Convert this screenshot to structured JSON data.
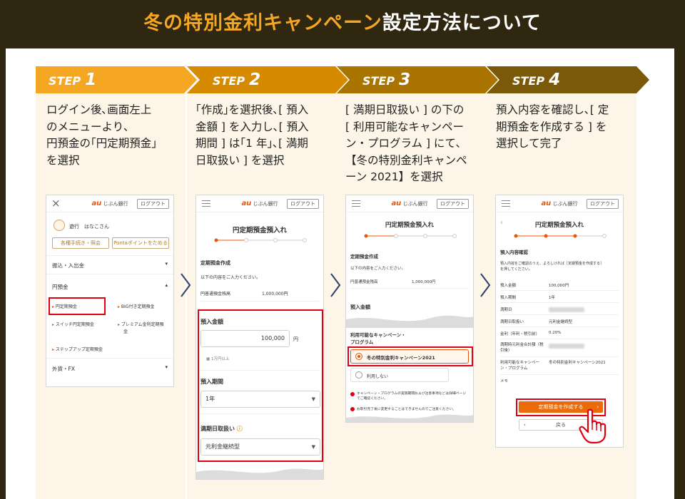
{
  "banner": {
    "title_highlight": "冬の特別金利キャンペーン",
    "title_rest": "設定方法について"
  },
  "colors": {
    "dark": "#2f2710",
    "orange": "#f5a623",
    "step1": "#f5a623",
    "step2": "#d58a00",
    "step3": "#a97400",
    "step4": "#7a5a08",
    "col_bg": "#fdf5e7",
    "red": "#e1000f",
    "brand": "#eb5505"
  },
  "steps": [
    {
      "label": "STEP",
      "num": "1",
      "lines": [
        "ログイン後､画面左上",
        "のメニューより､",
        "円預金の｢円定期預金｣",
        "を選択"
      ]
    },
    {
      "label": "STEP",
      "num": "2",
      "lines": [
        "｢作成｣を選択後､[ 預入",
        "金額 ] を入力し､[ 預入",
        "期間 ] は｢1 年｣､[ 満期",
        "日取扱い ] を選択"
      ]
    },
    {
      "label": "STEP",
      "num": "3",
      "lines": [
        "[ 満期日取扱い ] の下の",
        "[ 利用可能なキャンペー",
        "ン・プログラム ] にて､",
        "【冬の特別金利キャンペ",
        "ーン 2021】を選択"
      ]
    },
    {
      "label": "STEP",
      "num": "4",
      "lines": [
        "預入内容を確認し､[ 定",
        "期預金を作成する ] を",
        "選択して完了"
      ]
    }
  ],
  "header": {
    "au": "au",
    "bank": "じぶん銀行",
    "logout": "ログアウト"
  },
  "phone1": {
    "user": "遊行　はなこさん",
    "btn_procedures": "各種手続き・照会",
    "btn_ponta": "Pontaポイントをためる",
    "menu_transfer": "振込・入出金",
    "menu_yen": "円預金",
    "sub_items": [
      "円定期預金",
      "BIG付き定期預金",
      "スイッチ円定期預金",
      "プレミアム金利定期預",
      "金",
      "ステップアップ定期預金"
    ],
    "menu_fx": "外貨・FX"
  },
  "phone2": {
    "title": "円定期預金預入れ",
    "section": "定期預金作成",
    "instruction": "以下の内容をご入力ください。",
    "balance_label": "円普通預金残高",
    "balance_value": "1,000,000円",
    "amount_label": "預入金額",
    "amount_value": "100,000",
    "amount_unit": "円",
    "amount_note": "1万円以上",
    "period_label": "預入期間",
    "period_value": "1年",
    "maturity_label": "満期日取扱い",
    "maturity_value": "元利金継続型"
  },
  "phone3": {
    "title": "円定期預金預入れ",
    "section": "定期預金作成",
    "instruction": "以下の内容をご入力ください。",
    "balance_label": "円普通預金残高",
    "balance_value": "1,000,000円",
    "amount_label": "預入金額",
    "campaign_label_1": "利用可能なキャンペーン・",
    "campaign_label_2": "プログラム",
    "option_campaign": "冬の特別金利キャンペーン2021",
    "option_none": "利用しない",
    "note1_a": "キャンペーン・プログラムの実施期間および注意事項などは詳細ページ",
    "note1_b": "でご確認ください。",
    "note2": "お取引完了後に変更することはできませんのでご注意ください。"
  },
  "phone4": {
    "title": "円定期預金預入れ",
    "section": "預入内容確認",
    "instruction_1": "預入内容をご確認のうえ、よろしければ［定期預金を作成する］",
    "instruction_2": "を押してください。",
    "rows": [
      {
        "label": "預入金額",
        "value": "100,000円"
      },
      {
        "label": "預入期間",
        "value": "1年"
      },
      {
        "label": "満期日",
        "value": ""
      },
      {
        "label": "満期日取扱い",
        "value": "元利金継続型"
      },
      {
        "label": "金利（年利・税引前）",
        "value": "0.20%"
      },
      {
        "label": "満期時元利金合計額（税引後）",
        "value": ""
      },
      {
        "label": "利用可能なキャンペーン・プログラム",
        "value": "冬の特別金利キャンペーン2021"
      },
      {
        "label": "メモ",
        "value": ""
      }
    ],
    "create_button": "定期預金を作成する",
    "back_button": "戻る"
  }
}
